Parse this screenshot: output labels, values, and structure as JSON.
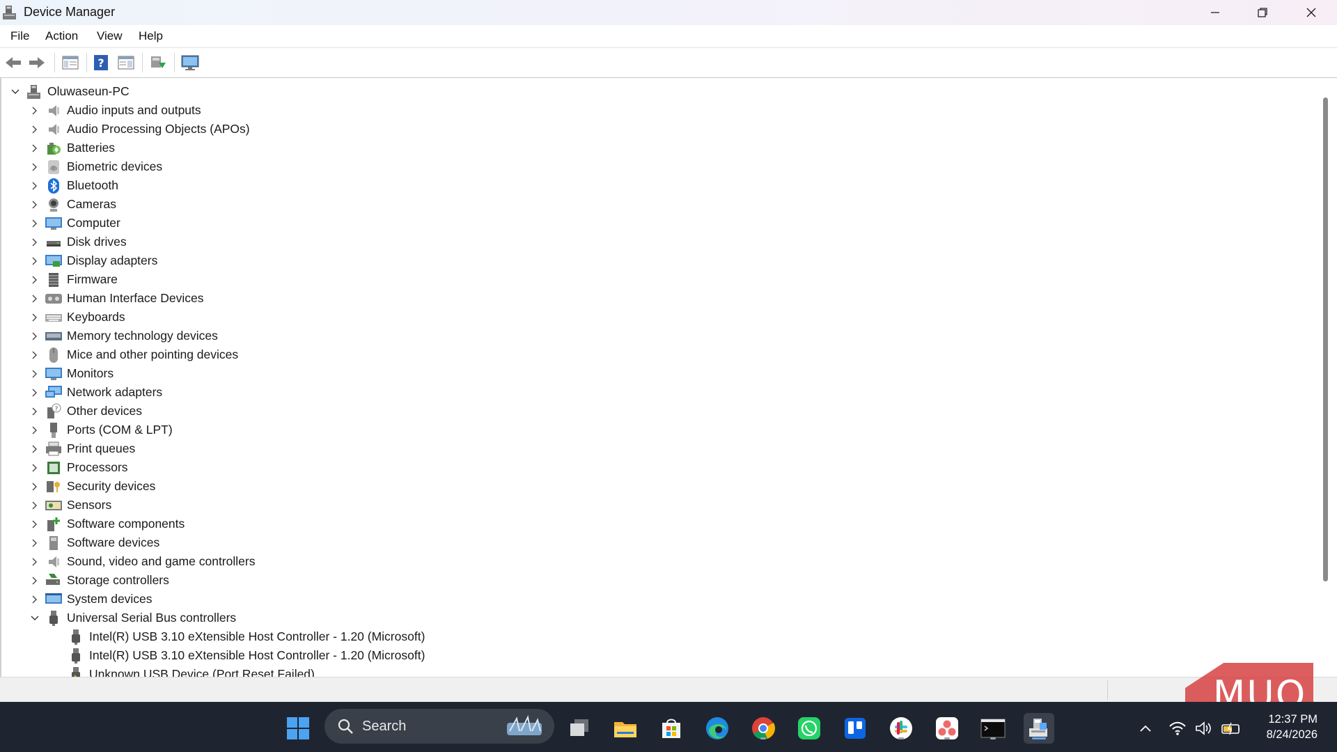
{
  "window": {
    "title": "Device Manager"
  },
  "menu": [
    "File",
    "Action",
    "View",
    "Help"
  ],
  "toolbar": {
    "buttons": [
      "back-icon",
      "forward-icon",
      "show-hide-console-tree-icon",
      "help-icon",
      "properties-icon",
      "update-driver-icon",
      "scan-hardware-icon"
    ]
  },
  "tree": {
    "root": "Oluwaseun-PC",
    "categories": [
      {
        "label": "Audio inputs and outputs",
        "icon": "speaker-icon"
      },
      {
        "label": "Audio Processing Objects (APOs)",
        "icon": "speaker-icon"
      },
      {
        "label": "Batteries",
        "icon": "battery-icon"
      },
      {
        "label": "Biometric devices",
        "icon": "fingerprint-icon"
      },
      {
        "label": "Bluetooth",
        "icon": "bluetooth-icon"
      },
      {
        "label": "Cameras",
        "icon": "camera-icon"
      },
      {
        "label": "Computer",
        "icon": "computer-icon"
      },
      {
        "label": "Disk drives",
        "icon": "disk-icon"
      },
      {
        "label": "Display adapters",
        "icon": "display-adapter-icon"
      },
      {
        "label": "Firmware",
        "icon": "firmware-icon"
      },
      {
        "label": "Human Interface Devices",
        "icon": "hid-icon"
      },
      {
        "label": "Keyboards",
        "icon": "keyboard-icon"
      },
      {
        "label": "Memory technology devices",
        "icon": "memory-icon"
      },
      {
        "label": "Mice and other pointing devices",
        "icon": "mouse-icon"
      },
      {
        "label": "Monitors",
        "icon": "monitor-icon"
      },
      {
        "label": "Network adapters",
        "icon": "network-icon"
      },
      {
        "label": "Other devices",
        "icon": "unknown-device-icon"
      },
      {
        "label": "Ports (COM & LPT)",
        "icon": "port-icon"
      },
      {
        "label": "Print queues",
        "icon": "printer-icon"
      },
      {
        "label": "Processors",
        "icon": "processor-icon"
      },
      {
        "label": "Security devices",
        "icon": "security-icon"
      },
      {
        "label": "Sensors",
        "icon": "sensor-icon"
      },
      {
        "label": "Software components",
        "icon": "software-component-icon"
      },
      {
        "label": "Software devices",
        "icon": "software-device-icon"
      },
      {
        "label": "Sound, video and game controllers",
        "icon": "speaker-icon"
      },
      {
        "label": "Storage controllers",
        "icon": "storage-icon"
      },
      {
        "label": "System devices",
        "icon": "system-icon"
      },
      {
        "label": "Universal Serial Bus controllers",
        "icon": "usb-icon",
        "expanded": true
      }
    ],
    "usb_children": [
      "Intel(R) USB 3.10 eXtensible Host Controller - 1.20 (Microsoft)",
      "Intel(R) USB 3.10 eXtensible Host Controller - 1.20 (Microsoft)",
      "Unknown USB Device (Port Reset Failed)"
    ]
  },
  "watermark": "MUO",
  "taskbar": {
    "search_label": "Search",
    "apps": [
      "start-icon",
      "task-view-icon",
      "file-explorer-icon",
      "store-icon",
      "edge-icon",
      "chrome-icon",
      "whatsapp-icon",
      "trello-icon",
      "slack-icon",
      "asana-icon",
      "terminal-icon",
      "device-manager-icon"
    ],
    "tray": [
      "chevron-up-icon",
      "wifi-icon",
      "volume-icon",
      "battery-icon"
    ],
    "time": "12:37 PM",
    "date": "8/24/2026"
  },
  "colors": {
    "titlebar": "#eef4fb",
    "taskbar": "#1f2530",
    "accent": "#5aa7ff",
    "watermark": "#d63a3a"
  }
}
